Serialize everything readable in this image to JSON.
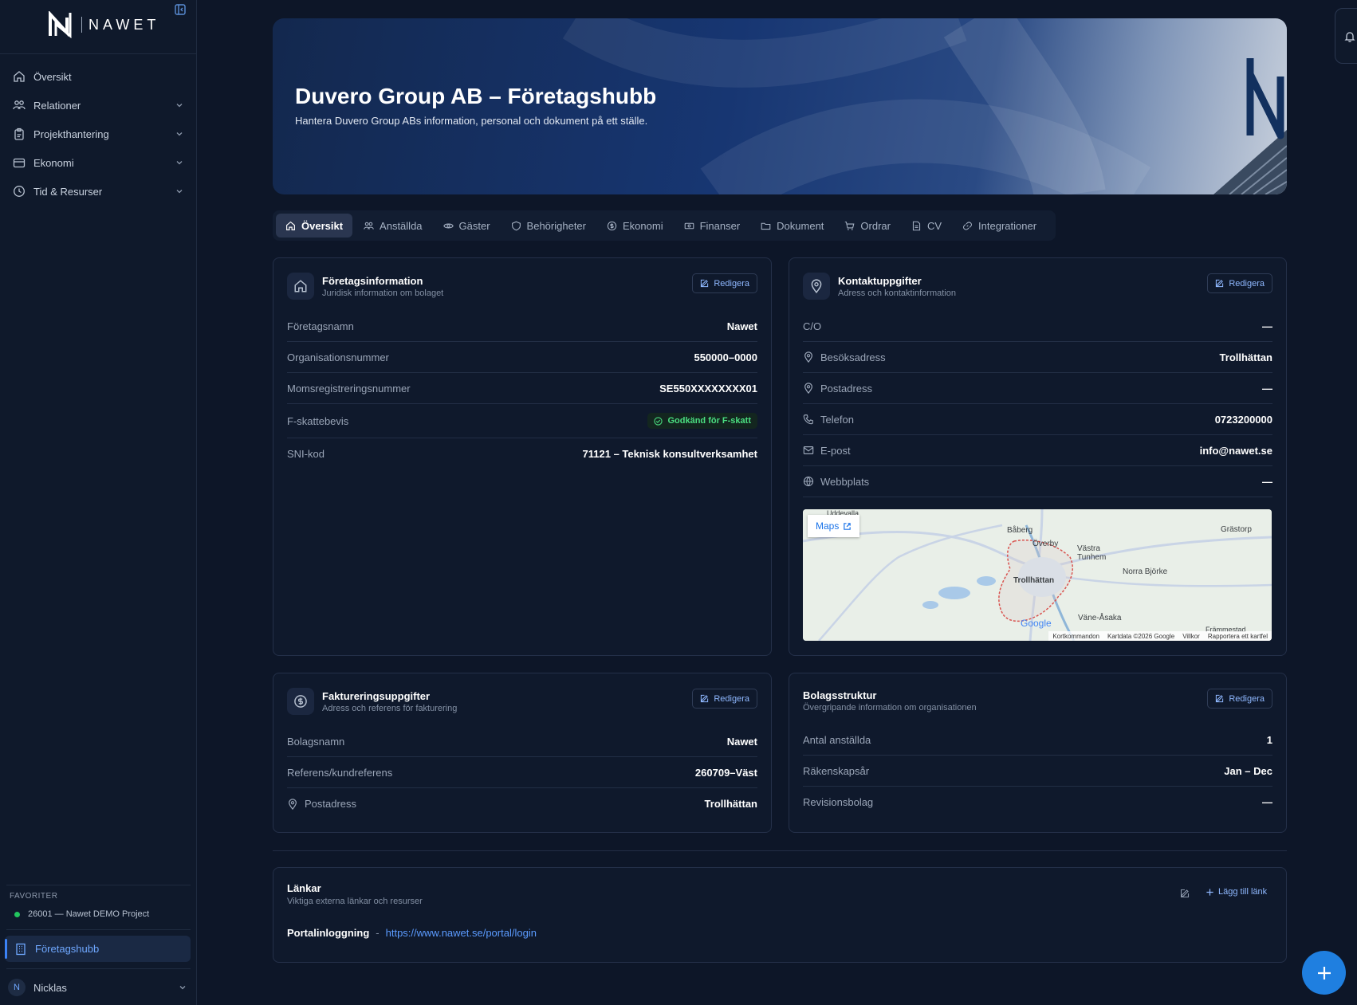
{
  "brand": {
    "name": "NAWET"
  },
  "sidebar": {
    "items": [
      {
        "label": "Översikt"
      },
      {
        "label": "Relationer"
      },
      {
        "label": "Projekthantering"
      },
      {
        "label": "Ekonomi"
      },
      {
        "label": "Tid & Resurser"
      }
    ],
    "favorites_title": "FAVORITER",
    "favorites": [
      {
        "label": "26001 — Nawet DEMO Project"
      }
    ],
    "active_item": "Företagshubb",
    "user": {
      "initial": "N",
      "name": "Nicklas"
    }
  },
  "hero": {
    "title": "Duvero Group AB – Företagshubb",
    "subtitle": "Hantera Duvero Group ABs information, personal och dokument på ett ställe."
  },
  "tabs": [
    {
      "label": "Översikt",
      "icon": "home-icon",
      "active": true
    },
    {
      "label": "Anställda",
      "icon": "users-icon"
    },
    {
      "label": "Gäster",
      "icon": "eye-icon"
    },
    {
      "label": "Behörigheter",
      "icon": "shield-icon"
    },
    {
      "label": "Ekonomi",
      "icon": "dollar-icon"
    },
    {
      "label": "Finanser",
      "icon": "banknote-icon"
    },
    {
      "label": "Dokument",
      "icon": "folder-icon"
    },
    {
      "label": "Ordrar",
      "icon": "cart-icon"
    },
    {
      "label": "CV",
      "icon": "file-icon"
    },
    {
      "label": "Integrationer",
      "icon": "link-icon"
    }
  ],
  "edit_label": "Redigera",
  "company_info": {
    "title": "Företagsinformation",
    "subtitle": "Juridisk information om bolaget",
    "rows": [
      {
        "key": "Företagsnamn",
        "value": "Nawet"
      },
      {
        "key": "Organisationsnummer",
        "value": "550000–0000"
      },
      {
        "key": "Momsregistreringsnummer",
        "value": "SE550XXXXXXXX01"
      },
      {
        "key": "F-skattebevis",
        "value": "Godkänd för F-skatt"
      },
      {
        "key": "SNI-kod",
        "value": "71121 – Teknisk konsultverksamhet"
      }
    ]
  },
  "contact": {
    "title": "Kontaktuppgifter",
    "subtitle": "Adress och kontaktinformation",
    "rows": [
      {
        "key": "C/O",
        "value": "—"
      },
      {
        "key": "Besöksadress",
        "value": "Trollhättan",
        "icon": "pin-icon"
      },
      {
        "key": "Postadress",
        "value": "—",
        "icon": "pin-icon"
      },
      {
        "key": "Telefon",
        "value": "0723200000",
        "icon": "phone-icon"
      },
      {
        "key": "E-post",
        "value": "info@nawet.se",
        "icon": "mail-icon"
      },
      {
        "key": "Webbplats",
        "value": "—",
        "icon": "globe-icon"
      }
    ],
    "map": {
      "button": "Maps",
      "labels": [
        "Uddevalla",
        "Båberg",
        "Överby",
        "Västra Tunhem",
        "Norra Björke",
        "Trollhättan",
        "Väne-Åsaka",
        "Grästorp",
        "Främmestad",
        "Google"
      ],
      "footer": [
        "Kortkommandon",
        "Kartdata ©2026 Google",
        "Villkor",
        "Rapportera ett kartfel"
      ]
    }
  },
  "billing": {
    "title": "Faktureringsuppgifter",
    "subtitle": "Adress och referens för fakturering",
    "rows": [
      {
        "key": "Bolagsnamn",
        "value": "Nawet"
      },
      {
        "key": "Referens/kundreferens",
        "value": "260709–Väst"
      },
      {
        "key": "Postadress",
        "value": "Trollhättan",
        "icon": "pin-icon"
      }
    ]
  },
  "structure": {
    "title": "Bolagsstruktur",
    "subtitle": "Övergripande information om organisationen",
    "rows": [
      {
        "key": "Antal anställda",
        "value": "1"
      },
      {
        "key": "Räkenskapsår",
        "value": "Jan – Dec"
      },
      {
        "key": "Revisionsbolag",
        "value": "—"
      }
    ]
  },
  "links": {
    "title": "Länkar",
    "subtitle": "Viktiga externa länkar och resurser",
    "add_label": "Lägg till länk",
    "items": [
      {
        "label": "Portalinloggning",
        "sep": "-",
        "url": "https://www.nawet.se/portal/login"
      }
    ]
  }
}
